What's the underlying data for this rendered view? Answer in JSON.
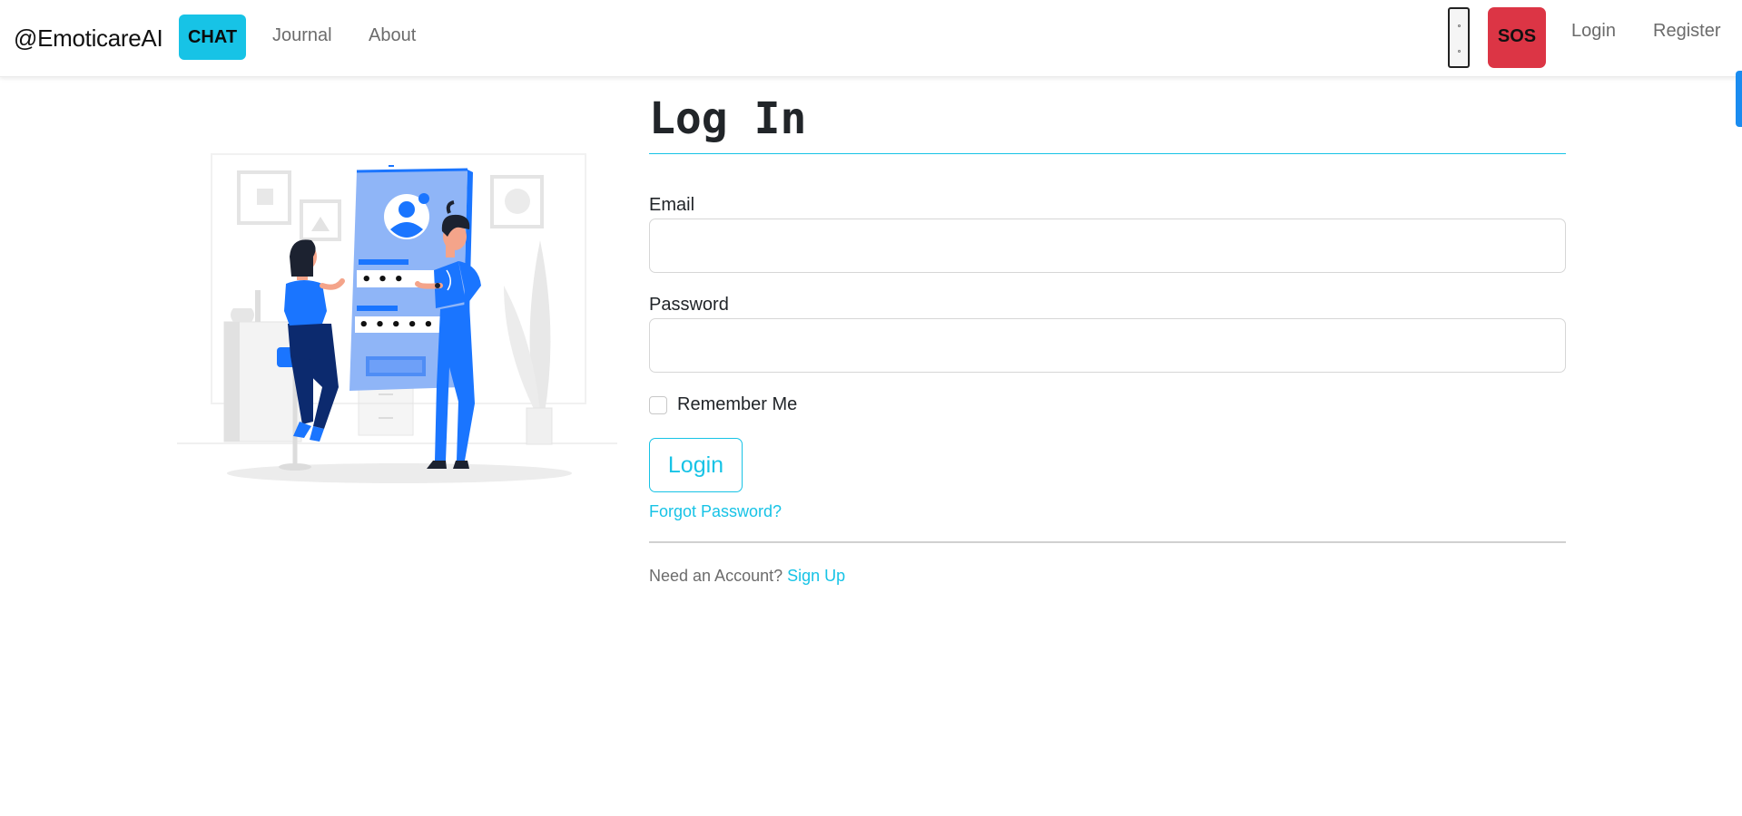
{
  "navbar": {
    "brand": "@EmoticareAI",
    "chat_label": "CHAT",
    "links": {
      "journal": "Journal",
      "about": "About"
    },
    "sos_label": "SOS",
    "login_label": "Login",
    "register_label": "Register"
  },
  "form": {
    "title": "Log In",
    "email_label": "Email",
    "email_value": "",
    "password_label": "Password",
    "password_value": "",
    "remember_label": "Remember Me",
    "remember_checked": false,
    "submit_label": "Login",
    "forgot_label": "Forgot Password?",
    "signup_prompt": "Need an Account?",
    "signup_link": "Sign Up"
  },
  "illustration": {
    "subject": "login-screen-people-illustration",
    "phone_dots_row1": "• • •",
    "phone_dots_row2": "• • • • •"
  },
  "colors": {
    "accent": "#17c3e6",
    "sos": "#dc3545",
    "illustration_blue": "#1a75ff",
    "illustration_light_blue": "#8fb5f7",
    "illustration_navy": "#0c2a6e"
  }
}
